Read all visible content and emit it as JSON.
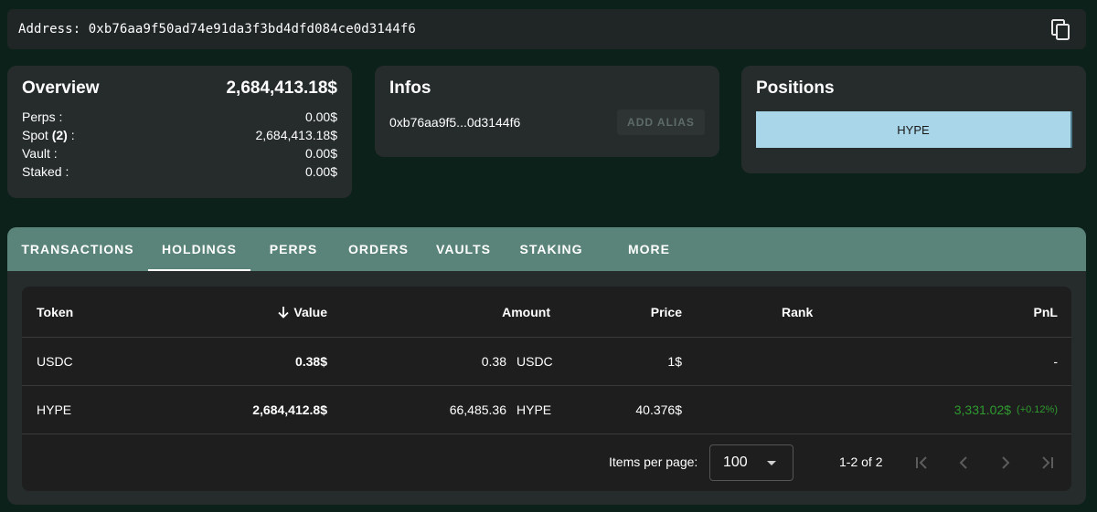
{
  "address_bar": {
    "text": "Address: 0xb76aa9f50ad74e91da3f3bd4dfd084ce0d3144f6"
  },
  "overview": {
    "title": "Overview",
    "total": "2,684,413.18$",
    "rows": [
      {
        "label": "Perps :",
        "value": "0.00$"
      },
      {
        "label_prefix": "Spot ",
        "label_count": "(2)",
        "label_suffix": " :",
        "value": "2,684,413.18$"
      },
      {
        "label": "Vault :",
        "value": "0.00$"
      },
      {
        "label": "Staked :",
        "value": "0.00$"
      }
    ]
  },
  "infos": {
    "title": "Infos",
    "address_short": "0xb76aa9f5...0d3144f6",
    "alias_button": "ADD ALIAS"
  },
  "positions": {
    "title": "Positions",
    "items": [
      "HYPE"
    ]
  },
  "tabs": [
    {
      "label": "TRANSACTIONS"
    },
    {
      "label": "HOLDINGS",
      "active": true
    },
    {
      "label": "PERPS"
    },
    {
      "label": "ORDERS"
    },
    {
      "label": "VAULTS"
    },
    {
      "label": "STAKING"
    },
    {
      "label": "MORE"
    }
  ],
  "holdings": {
    "columns": {
      "token": "Token",
      "value": "Value",
      "amount": "Amount",
      "price": "Price",
      "rank": "Rank",
      "pnl": "PnL"
    },
    "sort_icon": "arrow-down-icon",
    "rows": [
      {
        "token": "USDC",
        "value": "0.38$",
        "amount": "0.38",
        "amount_unit": "USDC",
        "price": "1$",
        "rank": "",
        "pnl": "-",
        "pnl_pct": ""
      },
      {
        "token": "HYPE",
        "value": "2,684,412.8$",
        "amount": "66,485.36",
        "amount_unit": "HYPE",
        "price": "40.376$",
        "rank": "",
        "pnl": "3,331.02$",
        "pnl_pct": "(+0.12%)"
      }
    ]
  },
  "paginator": {
    "items_per_page_label": "Items per page:",
    "page_size": "100",
    "range": "1-2 of 2"
  },
  "colors": {
    "background": "#0b2119",
    "card": "#262c2c",
    "tab_bar": "#5a8479",
    "position_chip": "#a9d6e9",
    "pnl_positive": "#2f9a2f"
  }
}
